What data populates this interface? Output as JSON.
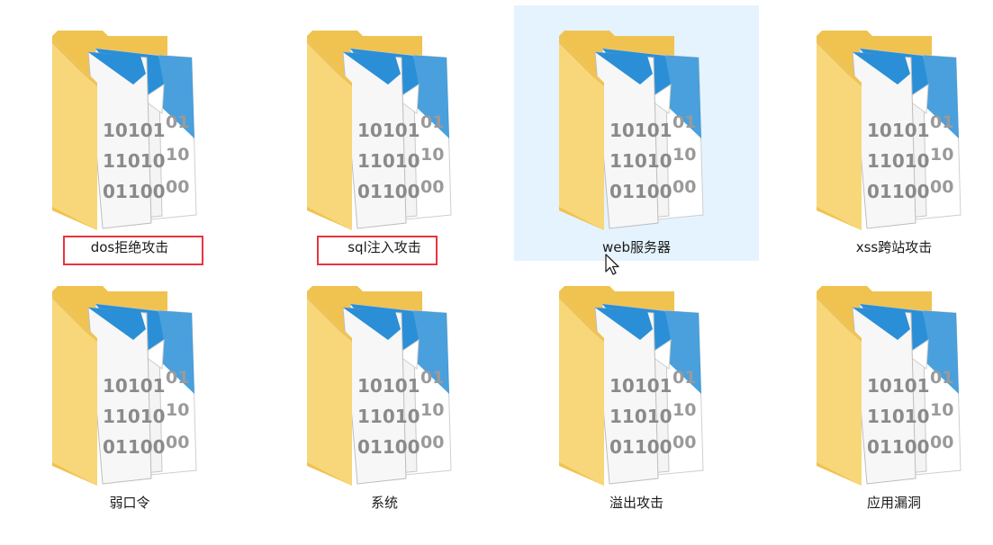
{
  "colors": {
    "folder_back": "#f0c24f",
    "folder_front": "#f8d77a",
    "doc_blue": "#2a8fd6",
    "page_bg": "#f4f4f4",
    "hover_bg": "#e5f3ff",
    "highlight_border": "#e8343f"
  },
  "folders": [
    {
      "name": "dos拒绝攻击",
      "icon": "binary-folder-icon",
      "highlighted": true,
      "hovered": false
    },
    {
      "name": "sql注入攻击",
      "icon": "binary-folder-icon",
      "highlighted": true,
      "hovered": false
    },
    {
      "name": "web服务器",
      "icon": "binary-folder-icon",
      "highlighted": false,
      "hovered": true
    },
    {
      "name": "xss跨站攻击",
      "icon": "binary-folder-icon",
      "highlighted": false,
      "hovered": false
    },
    {
      "name": "弱口令",
      "icon": "binary-folder-icon",
      "highlighted": false,
      "hovered": false
    },
    {
      "name": "系统",
      "icon": "binary-folder-icon",
      "highlighted": false,
      "hovered": false
    },
    {
      "name": "溢出攻击",
      "icon": "binary-folder-icon",
      "highlighted": false,
      "hovered": false
    },
    {
      "name": "应用漏洞",
      "icon": "binary-folder-icon",
      "highlighted": false,
      "hovered": false
    }
  ],
  "binary_text": {
    "line1": "10101",
    "line2": "11010",
    "line3": "01100",
    "back_line1": "01",
    "back_line2": "10",
    "back_line3": "00"
  }
}
